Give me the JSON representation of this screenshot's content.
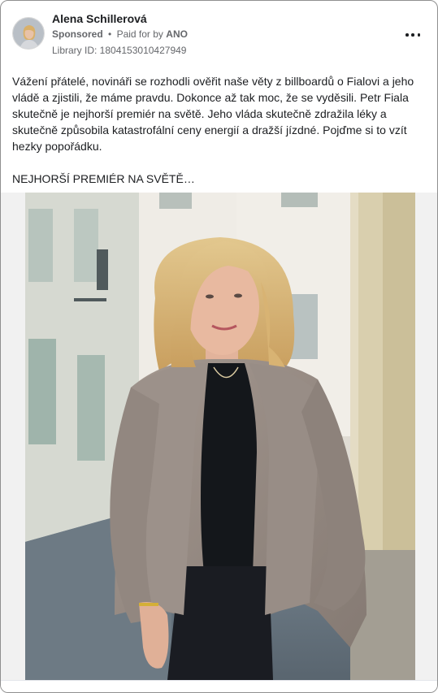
{
  "post": {
    "author": "Alena Schillerová",
    "sponsored_label": "Sponsored",
    "separator": "•",
    "paid_for_prefix": "Paid for by",
    "payer": "ANO",
    "library_id": "Library ID: 1804153010427949",
    "more_icon": "more-horizontal-icon",
    "text_paragraphs": [
      "Vážení přátelé, novináři se rozhodli ověřit naše věty z billboardů o Fialovi a jeho vládě a zjistili, že máme pravdu. Dokonce až tak moc, že se vyděsili. Petr Fiala skutečně je nejhorší premiér na světě. Jeho vláda skutečně zdražila léky a skutečně způsobila katastrofální ceny energií a dražší jízdné. Pojďme si to vzít hezky popořádku.",
      "NEJHORŠÍ PREMIÉR NA SVĚTĚ…"
    ]
  },
  "colors": {
    "text_primary": "#1c1e21",
    "text_secondary": "#65676b",
    "card_border": "#8f8f8f",
    "media_background": "#f1f1f1"
  }
}
